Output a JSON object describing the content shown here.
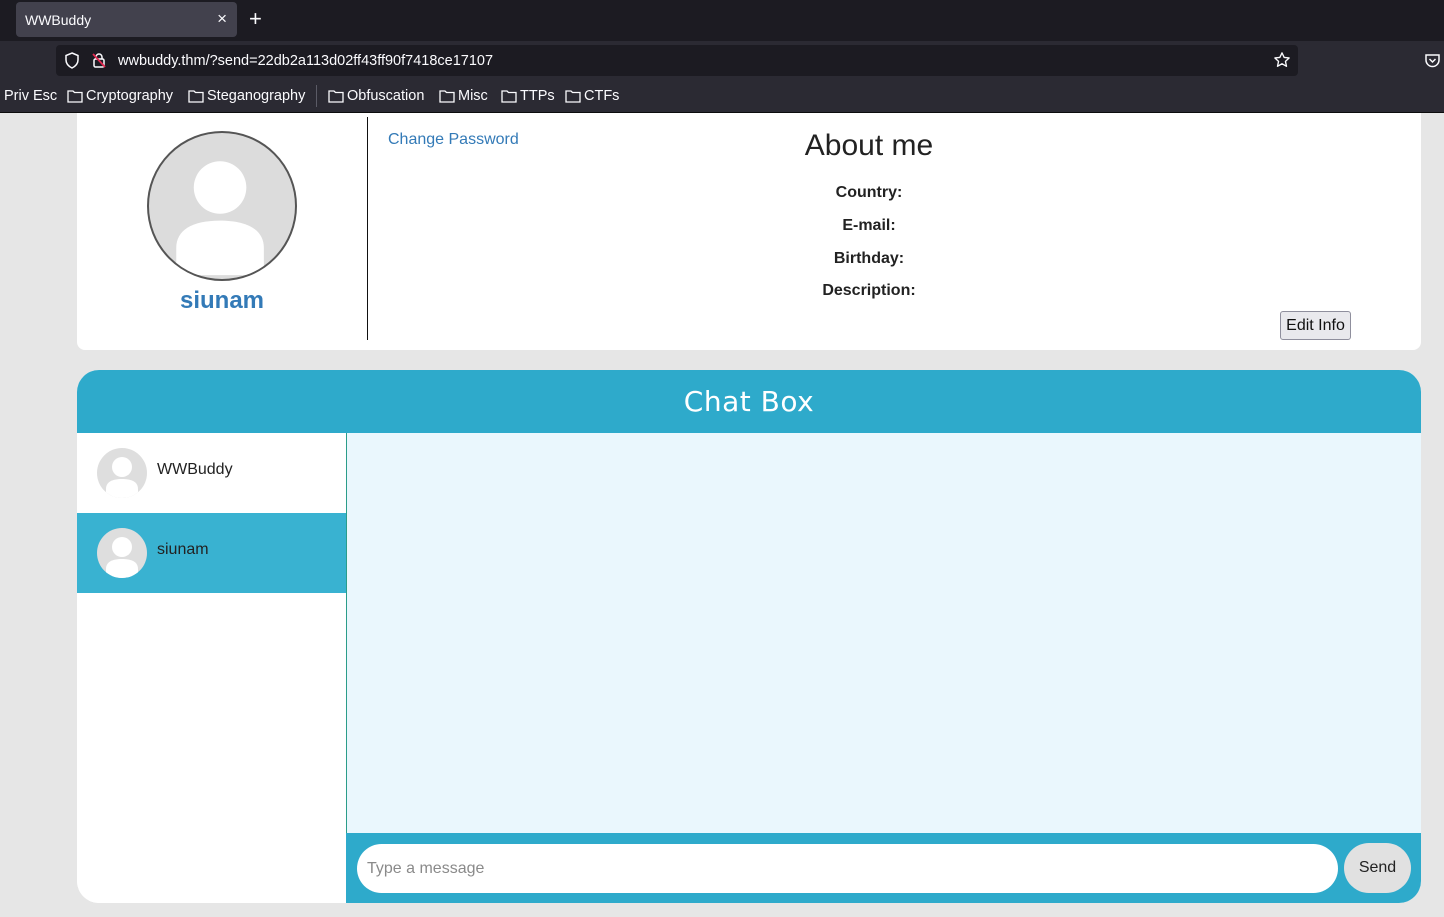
{
  "browser": {
    "tab_title": "WWBuddy",
    "tab_close": "×",
    "new_tab": "+",
    "url": "wwbuddy.thm/?send=22db2a113d02ff43ff90f7418ce17107",
    "bookmarks": [
      "Priv Esc",
      "Cryptography",
      "Steganography",
      "Obfuscation",
      "Misc",
      "TTPs",
      "CTFs"
    ]
  },
  "profile": {
    "username": "siunam",
    "change_password": "Change Password",
    "about_title": "About me",
    "fields": {
      "country": "Country:",
      "email": "E-mail:",
      "birthday": "Birthday:",
      "description": "Description:"
    },
    "edit_button": "Edit Info"
  },
  "chat": {
    "title": "Chat Box",
    "contacts": [
      {
        "name": "WWBuddy",
        "active": false
      },
      {
        "name": "siunam",
        "active": true
      }
    ],
    "input_placeholder": "Type a message",
    "send_button": "Send"
  },
  "colors": {
    "accent": "#2eaacb",
    "active_contact": "#39b2d1",
    "link": "#337ab7",
    "message_bg": "#eaf7fd"
  }
}
